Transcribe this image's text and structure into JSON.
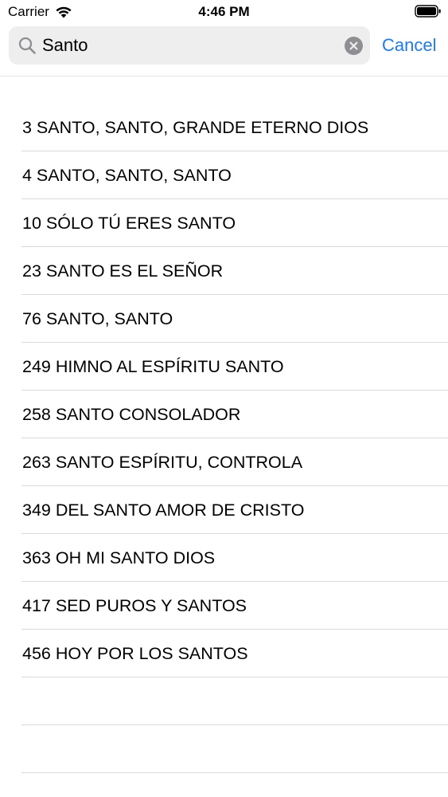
{
  "status_bar": {
    "carrier": "Carrier",
    "time": "4:46 PM"
  },
  "search": {
    "value": "Santo",
    "cancel_label": "Cancel"
  },
  "results": [
    "3 SANTO, SANTO, GRANDE ETERNO DIOS",
    "4 SANTO, SANTO, SANTO",
    "10 SÓLO TÚ ERES SANTO",
    "23 SANTO ES EL SEÑOR",
    "76 SANTO, SANTO",
    "249 HIMNO AL ESPÍRITU SANTO",
    "258 SANTO CONSOLADOR",
    "263 SANTO ESPÍRITU, CONTROLA",
    "349 DEL SANTO AMOR DE CRISTO",
    "363 OH MI SANTO DIOS",
    "417 SED PUROS Y SANTOS",
    "456 HOY POR LOS SANTOS"
  ],
  "colors": {
    "accent": "#1d7bf0",
    "search_field_bg": "#eeeeef",
    "separator": "#dadada"
  },
  "icons": [
    "wifi-icon",
    "battery-icon",
    "search-icon",
    "clear-icon"
  ]
}
